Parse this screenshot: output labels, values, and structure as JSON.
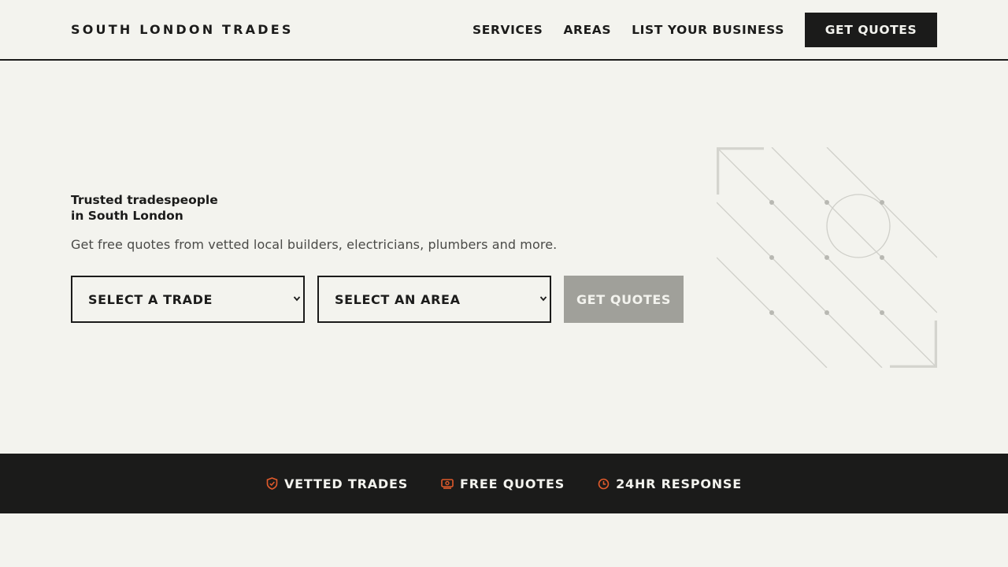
{
  "header": {
    "brand": "SOUTH LONDON TRADES",
    "nav": [
      {
        "label": "SERVICES"
      },
      {
        "label": "AREAS"
      },
      {
        "label": "LIST YOUR BUSINESS"
      }
    ],
    "cta_label": "GET QUOTES"
  },
  "hero": {
    "title_line1": "Trusted tradespeople",
    "title_line2": "in South London",
    "subtitle": "Get free quotes from vetted local builders, electricians, plumbers and more.",
    "trade_select": {
      "selected": "SELECT A TRADE"
    },
    "area_select": {
      "selected": "SELECT AN AREA"
    },
    "submit_label": "GET QUOTES"
  },
  "features": [
    {
      "icon": "shield-check-icon",
      "label": "VETTED TRADES"
    },
    {
      "icon": "quote-ticket-icon",
      "label": "FREE QUOTES"
    },
    {
      "icon": "clock-icon",
      "label": "24HR RESPONSE"
    }
  ],
  "colors": {
    "background": "#f3f3ee",
    "ink": "#1b1b1a",
    "muted_button": "#a0a09a",
    "accent": "#e05a2b",
    "decoration": "#c8c8c2"
  }
}
